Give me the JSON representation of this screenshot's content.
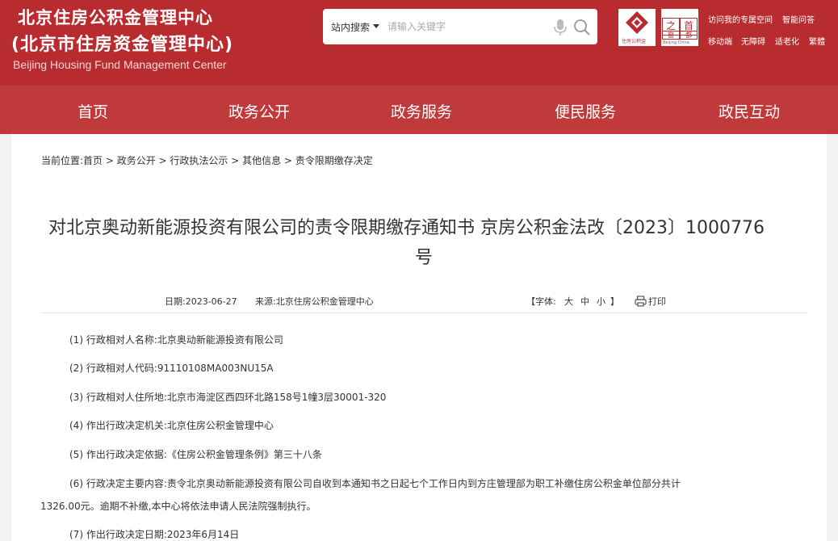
{
  "header": {
    "org_name_line1": "北京住房公积金管理中心",
    "org_name_line2": "(北京市住房资金管理中心)",
    "org_name_en": "Beijing Housing Fund Management Center",
    "search": {
      "scope": "站内搜索",
      "placeholder": "请输入关键字"
    },
    "logo_sub": "住房公积金",
    "seal": [
      "之",
      "首",
      "窗",
      "都"
    ],
    "seal_sub": "Beijing·China",
    "links": {
      "space": "访问我的专属空间",
      "qa": "智能问答",
      "mobile": "移动端",
      "accessible": "无障碍",
      "elderly": "适老化",
      "traditional": "繁體"
    },
    "colors": {
      "primary": "#b82c2f",
      "nav": "#c0393b"
    }
  },
  "nav": {
    "items": [
      "首页",
      "政务公开",
      "政务服务",
      "便民服务",
      "政民互动"
    ]
  },
  "breadcrumb": "当前位置:首页 > 政务公开 > 行政执法公示 > 其他信息 > 责令限期缴存决定",
  "article": {
    "title_line1": "对北京奥动新能源投资有限公司的责令限期缴存通知书 京房公积金法改〔2023〕1000776",
    "title_line2": "号",
    "date": "日期:2023-06-27",
    "source": "来源:北京住房公积金管理中心",
    "font_label": "【字体:",
    "font_large": "大",
    "font_medium": "中",
    "font_small": "小",
    "font_close": "】",
    "print_label": "打印",
    "items": [
      "(1) 行政相对人名称:北京奥动新能源投资有限公司",
      "(2) 行政相对人代码:91110108MA003NU15A",
      "(3) 行政相对人住所地:北京市海淀区西四环北路158号1幢3层30001-320",
      "(4) 作出行政决定机关:北京住房公积金管理中心",
      "(5) 作出行政决定依据:《住房公积金管理条例》第三十八条",
      "(6) 行政决定主要内容:责令北京奥动新能源投资有限公司自收到本通知书之日起七个工作日内到方庄管理部为职工补缴住房公积金单位部分共计",
      "(7) 作出行政决定日期:2023年6月14日"
    ],
    "item6_cont": "1326.00元。逾期不补缴,本中心将依法申请人民法院强制执行。"
  }
}
